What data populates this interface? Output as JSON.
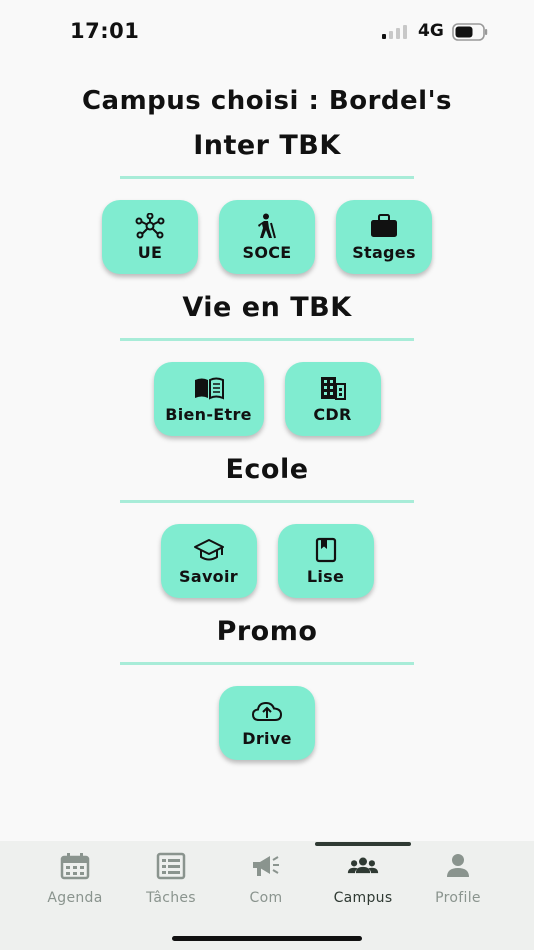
{
  "status_bar": {
    "time": "17:01",
    "network": "4G"
  },
  "campus_title": "Campus choisi : Bordel's",
  "sections": [
    {
      "title": "Inter TBK",
      "buttons": [
        {
          "label": "UE",
          "icon": "network-icon"
        },
        {
          "label": "SOCE",
          "icon": "walking-person-icon"
        },
        {
          "label": "Stages",
          "icon": "briefcase-icon"
        }
      ]
    },
    {
      "title": "Vie en TBK",
      "buttons": [
        {
          "label": "Bien-Etre",
          "icon": "open-book-icon"
        },
        {
          "label": "CDR",
          "icon": "building-icon"
        }
      ]
    },
    {
      "title": "Ecole",
      "buttons": [
        {
          "label": "Savoir",
          "icon": "graduation-cap-icon"
        },
        {
          "label": "Lise",
          "icon": "bookmark-book-icon"
        }
      ]
    },
    {
      "title": "Promo",
      "buttons": [
        {
          "label": "Drive",
          "icon": "cloud-upload-icon"
        }
      ]
    }
  ],
  "tabbar": {
    "active": "Campus",
    "tabs": [
      {
        "label": "Agenda",
        "icon": "calendar-icon"
      },
      {
        "label": "Tâches",
        "icon": "list-icon"
      },
      {
        "label": "Com",
        "icon": "megaphone-icon"
      },
      {
        "label": "Campus",
        "icon": "group-icon"
      },
      {
        "label": "Profile",
        "icon": "person-icon"
      }
    ]
  },
  "colors": {
    "tile": "#80ecd0",
    "divider": "#a8ecd8",
    "tab_active": "#2f3a33",
    "tab_inactive": "#8a948e"
  }
}
